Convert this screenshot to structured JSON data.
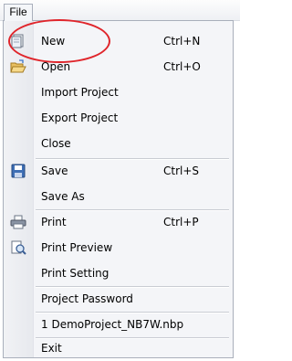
{
  "menubar": {
    "file_label": "File"
  },
  "menu": {
    "items": [
      {
        "label": "New",
        "shortcut": "Ctrl+N",
        "icon": "new-document-icon"
      },
      {
        "label": "Open",
        "shortcut": "Ctrl+O",
        "icon": "open-folder-icon"
      },
      {
        "label": "Import Project"
      },
      {
        "label": "Export Project"
      },
      {
        "label": "Close"
      },
      {
        "label": "Save",
        "shortcut": "Ctrl+S",
        "icon": "floppy-disk-icon"
      },
      {
        "label": "Save As"
      },
      {
        "label": "Print",
        "shortcut": "Ctrl+P",
        "icon": "printer-icon"
      },
      {
        "label": "Print Preview",
        "icon": "print-preview-icon"
      },
      {
        "label": "Print Setting"
      },
      {
        "label": "Project Password"
      },
      {
        "label": "1 DemoProject_NB7W.nbp"
      },
      {
        "label": "Exit"
      }
    ]
  },
  "colors": {
    "highlight_ellipse": "#e0252b",
    "menu_background": "#f4f5f8",
    "menu_border": "#a9afbb"
  }
}
